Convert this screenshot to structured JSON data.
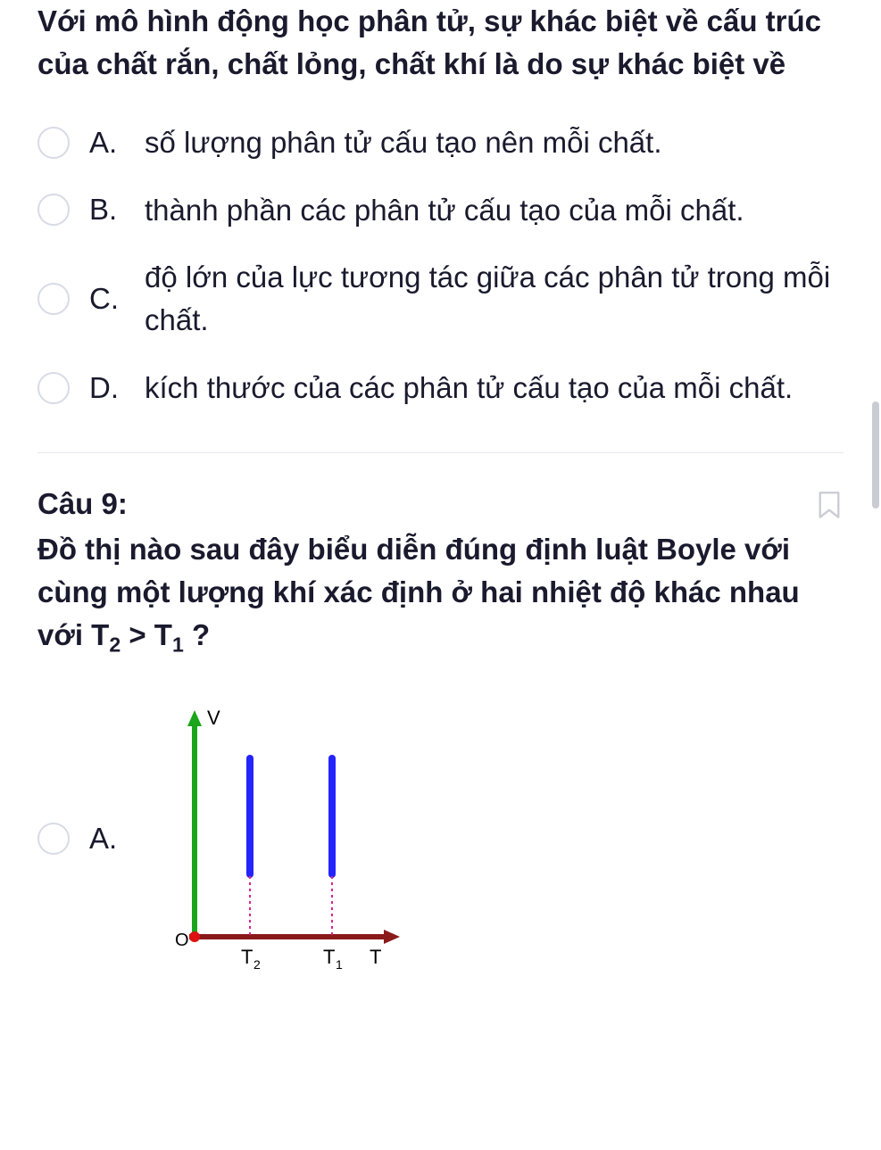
{
  "q8": {
    "stem": "Với mô hình động học phân tử, sự khác biệt về cấu trúc của chất rắn, chất lỏng, chất khí là do sự khác biệt về",
    "options": [
      {
        "letter": "A.",
        "text": "số lượng phân tử cấu tạo nên mỗi chất."
      },
      {
        "letter": "B.",
        "text": "thành phần các phân tử cấu tạo của mỗi chất."
      },
      {
        "letter": "C.",
        "text": "độ lớn của lực tương tác giữa các phân tử trong mỗi chất."
      },
      {
        "letter": "D.",
        "text": "kích thước của các phân tử cấu tạo của mỗi chất."
      }
    ]
  },
  "q9": {
    "number": "Câu 9:",
    "stem_html": "Đồ thị nào sau đây biểu diễn <b>đúng</b> định luật Boyle với cùng một lượng khí xác định ở hai nhiệt độ khác nhau với T<sub>2</sub> > T<sub>1</sub> ?",
    "optionA": {
      "letter": "A."
    }
  },
  "chart_data": {
    "type": "diagram",
    "description": "V vs T axes with two vertical blue line segments at T2 and T1 (T2 left of T1 on axis labels shown)",
    "y_axis": {
      "label": "V",
      "color": "#1aa51a"
    },
    "x_axis": {
      "label": "T",
      "color": "#8b1a1a"
    },
    "origin_label": "O",
    "ticks_x": [
      "T₂",
      "T₁"
    ],
    "bars": [
      {
        "x_label": "T₂",
        "color": "#2424ff"
      },
      {
        "x_label": "T₁",
        "color": "#2424ff"
      }
    ]
  }
}
